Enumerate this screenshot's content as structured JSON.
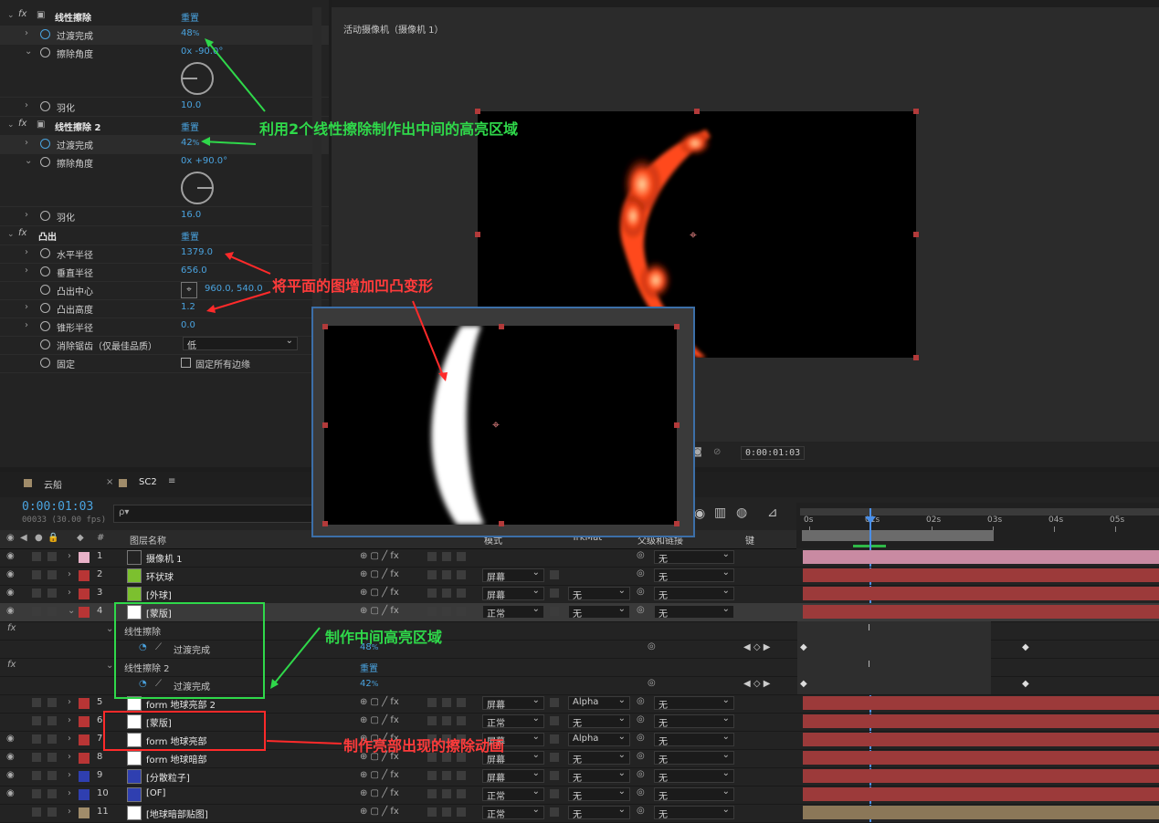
{
  "effects_panel": {
    "fx1": {
      "name": "线性擦除",
      "reset": "重置",
      "props": [
        {
          "name": "过渡完成",
          "value": "48",
          "unit": "%"
        },
        {
          "name": "擦除角度",
          "value": "0x -90.0°"
        },
        {
          "name": "羽化",
          "value": "10.0"
        }
      ]
    },
    "fx2": {
      "name": "线性擦除 2",
      "reset": "重置",
      "props": [
        {
          "name": "过渡完成",
          "value": "42",
          "unit": "%"
        },
        {
          "name": "擦除角度",
          "value": "0x +90.0°"
        },
        {
          "name": "羽化",
          "value": "16.0"
        }
      ]
    },
    "fx3": {
      "name": "凸出",
      "reset": "重置",
      "props": [
        {
          "name": "水平半径",
          "value": "1379.0"
        },
        {
          "name": "垂直半径",
          "value": "656.0"
        },
        {
          "name": "凸出中心",
          "value": "960.0, 540.0"
        },
        {
          "name": "凸出高度",
          "value": "1.2"
        },
        {
          "name": "锥形半径",
          "value": "0.0"
        },
        {
          "name": "消除锯齿（仅最佳品质）",
          "value": "低"
        },
        {
          "name": "固定",
          "value": "固定所有边缘"
        }
      ]
    }
  },
  "viewer": {
    "camera_label": "活动摄像机（摄像机 1）",
    "timecode": "0:00:01:03",
    "frame_colors": {
      "glow": "#ff4a1a",
      "hot": "#ffe6b0"
    }
  },
  "timeline": {
    "tabs": [
      {
        "label": "云船"
      },
      {
        "label": "SC2"
      }
    ],
    "timecode": "0:00:01:03",
    "fps": "00033 (30.00 fps)",
    "search_placeholder": "ρ▾",
    "headers": {
      "layer_name": "图层名称",
      "mode": "模式",
      "trkmat": "TrkMat",
      "parent": "父级和链接",
      "keys": "键"
    },
    "ruler": [
      "0s",
      "01s",
      "02s",
      "03s",
      "04s",
      "05s"
    ],
    "layers": [
      {
        "num": "1",
        "name": "摄像机 1",
        "color": "#e8b2c8",
        "mode": "",
        "trkmat": "",
        "parent": "无",
        "bar": "#c98aa2"
      },
      {
        "num": "2",
        "name": "环状球",
        "color": "#b83535",
        "mode": "屏幕",
        "trkmat": "",
        "parent": "无",
        "bar": "#9c3a3a"
      },
      {
        "num": "3",
        "name": "[外球]",
        "color": "#b83535",
        "mode": "屏幕",
        "trkmat": "无",
        "parent": "无",
        "bar": "#9c3a3a"
      },
      {
        "num": "4",
        "name": "[蒙版]",
        "color": "#b83535",
        "mode": "正常",
        "trkmat": "无",
        "parent": "无",
        "bar": "#9c3a3a"
      },
      {
        "num": "5",
        "name": "form 地球亮部 2",
        "color": "#b83535",
        "mode": "屏幕",
        "trkmat": "Alpha",
        "parent": "无",
        "bar": "#9c3a3a"
      },
      {
        "num": "6",
        "name": "[蒙版]",
        "color": "#b83535",
        "mode": "正常",
        "trkmat": "无",
        "parent": "无",
        "bar": "#9c3a3a"
      },
      {
        "num": "7",
        "name": "form 地球亮部",
        "color": "#b83535",
        "mode": "屏幕",
        "trkmat": "Alpha",
        "parent": "无",
        "bar": "#9c3a3a"
      },
      {
        "num": "8",
        "name": "form 地球暗部",
        "color": "#b83535",
        "mode": "屏幕",
        "trkmat": "无",
        "parent": "无",
        "bar": "#9c3a3a"
      },
      {
        "num": "9",
        "name": "[分散粒子]",
        "color": "#2f3fb0",
        "mode": "屏幕",
        "trkmat": "无",
        "parent": "无",
        "bar": "#9c3a3a"
      },
      {
        "num": "10",
        "name": "[OF]",
        "color": "#2f3fb0",
        "mode": "正常",
        "trkmat": "无",
        "parent": "无",
        "bar": "#9c3a3a"
      },
      {
        "num": "11",
        "name": "[地球暗部贴图]",
        "color": "#a08c6a",
        "mode": "正常",
        "trkmat": "无",
        "parent": "无",
        "bar": "#8b7758"
      }
    ],
    "sub_rows": [
      {
        "fx": "线性擦除",
        "prop": "过渡完成",
        "value": "48",
        "unit": "%"
      },
      {
        "fx": "线性擦除 2",
        "prop": "过渡完成",
        "value": "42",
        "unit": "%",
        "reset": "重置"
      }
    ]
  },
  "annotations": {
    "a1": "利用2个线性擦除制作出中间的高亮区域",
    "a2": "将平面的图增加凹凸变形",
    "a3": "制作中间高亮区域",
    "a4": "制作亮部出现的擦除动画"
  }
}
